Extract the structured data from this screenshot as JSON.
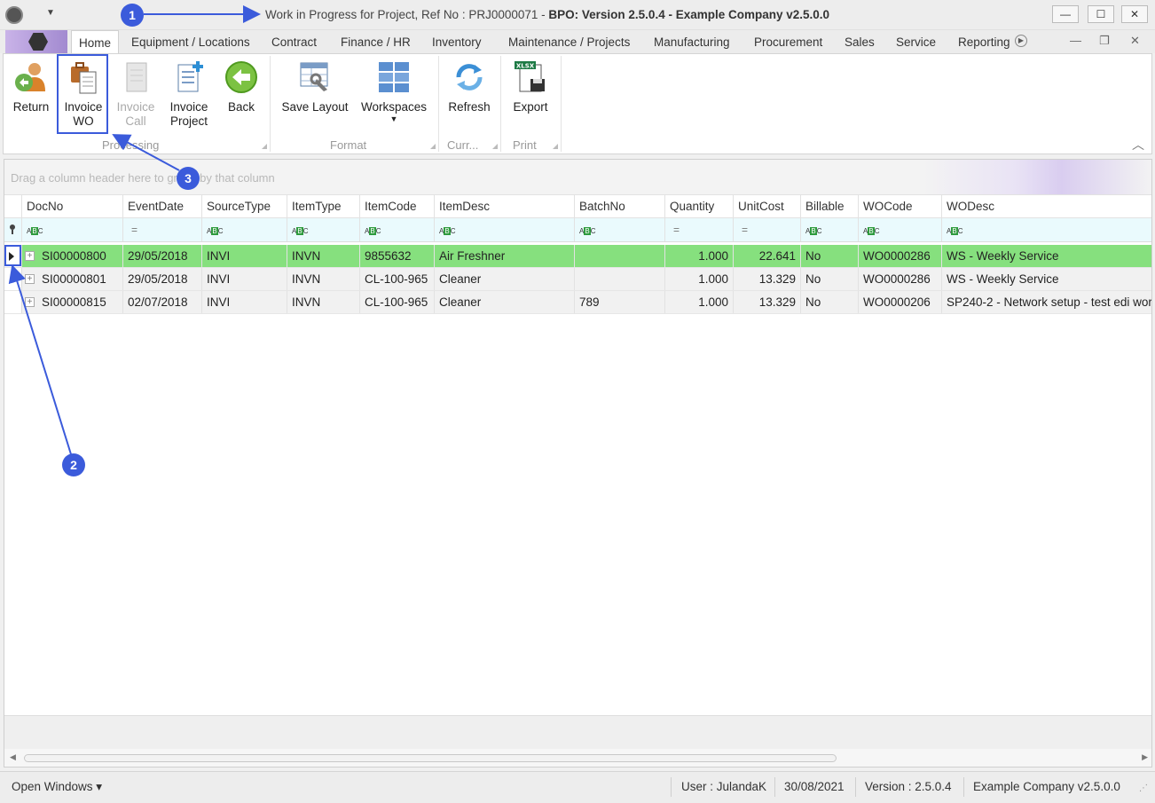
{
  "window": {
    "title_prefix": "Work in Progress for Project, Ref No : PRJ0000071 - ",
    "title_bold": "BPO: Version 2.5.0.4 - Example Company v2.5.0.0",
    "minimize": "—",
    "maximize": "☐",
    "close": "✕"
  },
  "menu": {
    "tabs": [
      "Home",
      "Equipment / Locations",
      "Contract",
      "Finance / HR",
      "Inventory",
      "Maintenance / Projects",
      "Manufacturing",
      "Procurement",
      "Sales",
      "Service",
      "Reporting"
    ],
    "mdi_minimize": "—",
    "mdi_restore": "❐",
    "mdi_close": "✕"
  },
  "ribbon": {
    "return": "Return",
    "invoice_wo_1": "Invoice",
    "invoice_wo_2": "WO",
    "invoice_call_1": "Invoice",
    "invoice_call_2": "Call",
    "invoice_project_1": "Invoice",
    "invoice_project_2": "Project",
    "back": "Back",
    "save_layout": "Save Layout",
    "workspaces": "Workspaces",
    "refresh": "Refresh",
    "export": "Export",
    "export_badge": "XLSX",
    "groups": {
      "processing": "Processing",
      "format": "Format",
      "curr": "Curr...",
      "print": "Print"
    }
  },
  "grid": {
    "group_panel_hint": "Drag a column header here to group by that column",
    "columns": [
      "DocNo",
      "EventDate",
      "SourceType",
      "ItemType",
      "ItemCode",
      "ItemDesc",
      "BatchNo",
      "Quantity",
      "UnitCost",
      "Billable",
      "WOCode",
      "WODesc"
    ],
    "filter_abc": "ABC",
    "filter_eq": "=",
    "rows": [
      [
        "SI00000800",
        "29/05/2018",
        "INVI",
        "INVN",
        "9855632",
        "Air Freshner",
        "",
        "1.000",
        "22.641",
        "No",
        "WO0000286",
        "WS - Weekly Service"
      ],
      [
        "SI00000801",
        "29/05/2018",
        "INVI",
        "INVN",
        "CL-100-965",
        "Cleaner",
        "",
        "1.000",
        "13.329",
        "No",
        "WO0000286",
        "WS - Weekly Service"
      ],
      [
        "SI00000815",
        "02/07/2018",
        "INVI",
        "INVN",
        "CL-100-965",
        "Cleaner",
        "789",
        "1.000",
        "13.329",
        "No",
        "WO0000206",
        "SP240-2 - Network setup - test edi wor"
      ]
    ],
    "expander": "+"
  },
  "status": {
    "open_windows": "Open Windows ▾",
    "user": "User : JulandaK",
    "date": "30/08/2021",
    "version": "Version : 2.5.0.4",
    "company": "Example Company v2.5.0.0"
  },
  "annotations": {
    "b1": "1",
    "b2": "2",
    "b3": "3"
  },
  "colors": {
    "accent": "#3b5bdb",
    "selected_row": "#86e07e"
  }
}
